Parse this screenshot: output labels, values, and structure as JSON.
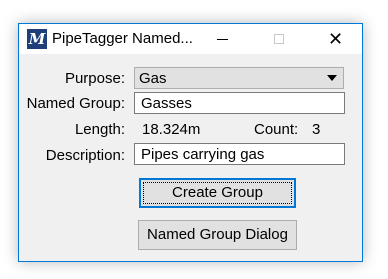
{
  "window": {
    "title": "PipeTagger Named...",
    "icon": "microstation-m-icon",
    "icon_glyph": "M"
  },
  "controls": {
    "minimize": "minimize-icon",
    "maximize": "maximize-icon",
    "close": "close-icon",
    "close_glyph": "✕"
  },
  "form": {
    "purpose_label": "Purpose:",
    "purpose_value": "Gas",
    "named_group_label": "Named Group:",
    "named_group_value": "Gasses",
    "length_label": "Length:",
    "length_value": "18.324m",
    "count_label": "Count:",
    "count_value": "3",
    "description_label": "Description:",
    "description_value": "Pipes carrying gas"
  },
  "buttons": {
    "create": "Create Group",
    "dialog": "Named Group Dialog"
  },
  "colors": {
    "accent": "#0078d7",
    "dialog_bg": "#f0f0f0",
    "icon_bg": "#1e3f7a"
  }
}
